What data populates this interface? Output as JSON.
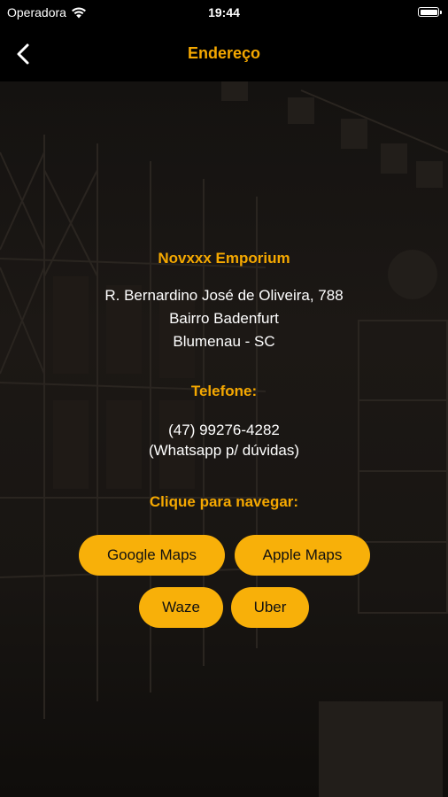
{
  "status_bar": {
    "carrier": "Operadora",
    "time": "19:44"
  },
  "header": {
    "title": "Endereço"
  },
  "store": {
    "name": "Novxxx Emporium",
    "address_line1": "R. Bernardino José de Oliveira, 788",
    "address_line2": "Bairro Badenfurt",
    "address_line3": "Blumenau - SC"
  },
  "contact": {
    "label": "Telefone:",
    "phone": "(47) 99276-4282",
    "note": "(Whatsapp p/ dúvidas)"
  },
  "navigation": {
    "label": "Clique para navegar:",
    "buttons": {
      "google": "Google Maps",
      "apple": "Apple Maps",
      "waze": "Waze",
      "uber": "Uber"
    }
  },
  "colors": {
    "accent": "#f5a800",
    "button": "#f8b009",
    "background": "#000000"
  },
  "icons": {
    "back": "chevron-left-icon",
    "wifi": "wifi-icon",
    "battery": "battery-icon"
  }
}
